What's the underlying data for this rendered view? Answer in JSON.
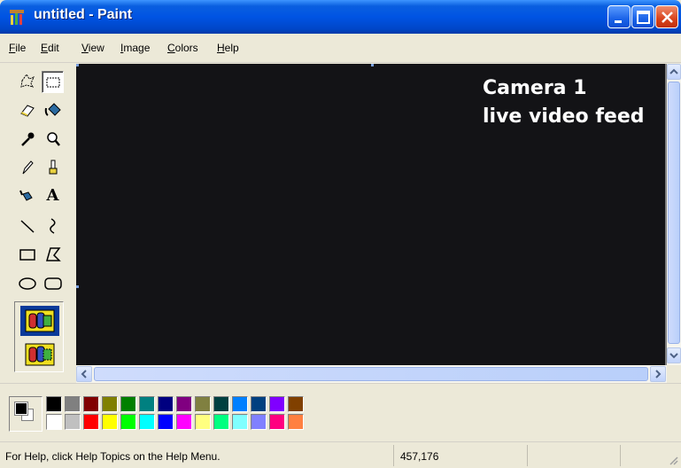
{
  "window": {
    "title": "untitled - Paint"
  },
  "menu": [
    {
      "key": "F",
      "rest": "ile"
    },
    {
      "key": "E",
      "rest": "dit"
    },
    {
      "key": "V",
      "rest": "iew"
    },
    {
      "key": "I",
      "rest": "mage"
    },
    {
      "key": "C",
      "rest": "olors"
    },
    {
      "key": "H",
      "rest": "elp"
    }
  ],
  "tools": [
    "free-form-select-icon",
    "select-icon",
    "eraser-icon",
    "fill-with-color-icon",
    "pick-color-icon",
    "magnifier-icon",
    "pencil-icon",
    "brush-icon",
    "airbrush-icon",
    "text-icon",
    "line-icon",
    "curve-icon",
    "rectangle-icon",
    "polygon-icon",
    "ellipse-icon",
    "rounded-rectangle-icon"
  ],
  "text_tool_glyph": "A",
  "canvas": {
    "caption_line1": "Camera 1",
    "caption_line2": "live video feed"
  },
  "palette": {
    "foreground": "#000000",
    "background": "#ffffff",
    "row1": [
      "#000000",
      "#808080",
      "#800000",
      "#808000",
      "#008000",
      "#008080",
      "#000080",
      "#800080",
      "#808040",
      "#004040",
      "#0080ff",
      "#004080",
      "#8000ff",
      "#804000"
    ],
    "row2": [
      "#ffffff",
      "#c0c0c0",
      "#ff0000",
      "#ffff00",
      "#00ff00",
      "#00ffff",
      "#0000ff",
      "#ff00ff",
      "#ffff80",
      "#00ff80",
      "#80ffff",
      "#8080ff",
      "#ff0080",
      "#ff8040"
    ]
  },
  "status": {
    "help_text": "For Help, click Help Topics on the Help Menu.",
    "coordinates": "457,176"
  }
}
